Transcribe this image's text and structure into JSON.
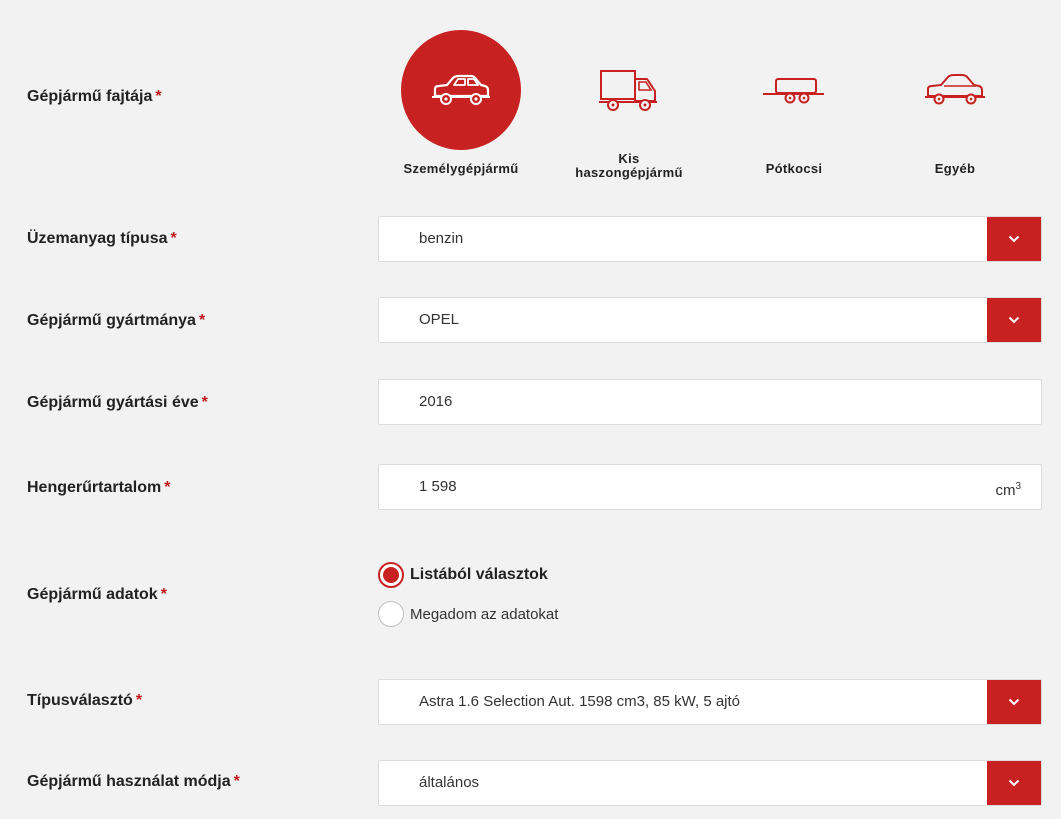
{
  "colors": {
    "accent": "#c72221",
    "background": "#f2f2f2"
  },
  "required_mark": "*",
  "vehicle_type": {
    "label": "Gépjármű fajtája",
    "options": [
      {
        "label": "Személygépjármű",
        "icon": "car-icon",
        "selected": true
      },
      {
        "label_line1": "Kis",
        "label_line2": "haszongépjármű",
        "icon": "van-icon",
        "selected": false
      },
      {
        "label": "Pótkocsi",
        "icon": "trailer-icon",
        "selected": false
      },
      {
        "label": "Egyéb",
        "icon": "other-vehicle-icon",
        "selected": false
      }
    ]
  },
  "fuel_type": {
    "label": "Üzemanyag típusa",
    "value": "benzin"
  },
  "make": {
    "label": "Gépjármű gyártmánya",
    "value": "OPEL"
  },
  "year": {
    "label": "Gépjármű gyártási éve",
    "value": "2016"
  },
  "displacement": {
    "label": "Hengerűrtartalom",
    "value": "1 598",
    "unit_base": "cm",
    "unit_sup": "3"
  },
  "vehicle_data": {
    "label": "Gépjármű adatok",
    "options": [
      {
        "label": "Listából választok",
        "checked": true
      },
      {
        "label": "Megadom az adatokat",
        "checked": false
      }
    ]
  },
  "type_selector": {
    "label": "Típusválasztó",
    "value": "Astra 1.6 Selection Aut. 1598 cm3, 85 kW, 5 ajtó"
  },
  "usage_mode": {
    "label": "Gépjármű használat módja",
    "value": "általános"
  }
}
